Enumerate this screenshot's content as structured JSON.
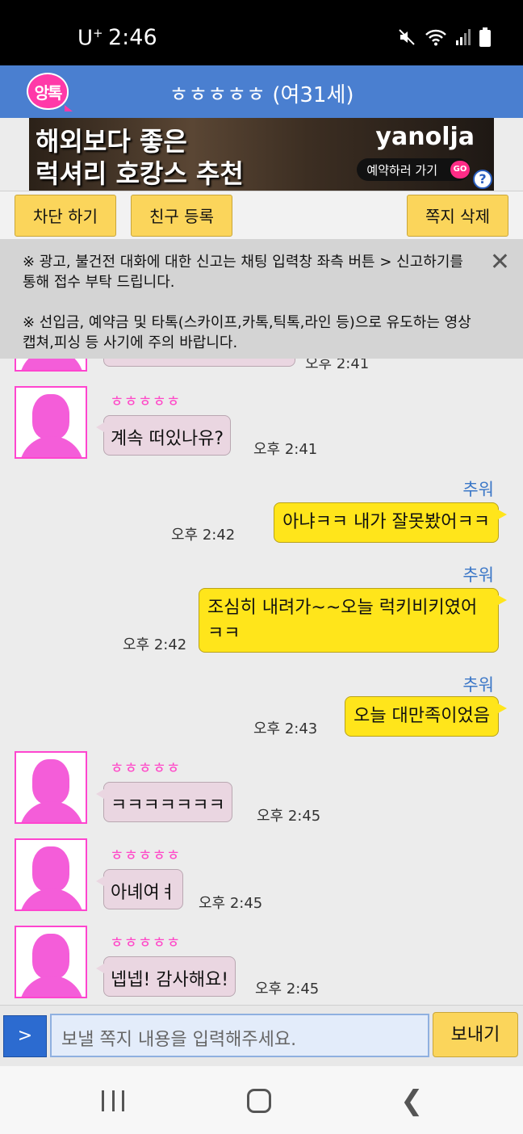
{
  "status_bar": {
    "carrier": "U",
    "carrier_sup": "+",
    "time": "2:46"
  },
  "app": {
    "logo_text": "앙톡",
    "title": "ㅎㅎㅎㅎㅎ (여31세)"
  },
  "ad": {
    "line1": "해외보다 좋은",
    "line2": "럭셔리 호캉스 추천",
    "brand": "yanolja",
    "cta": "예약하러 가기",
    "go": "GO",
    "help": "?"
  },
  "actions": {
    "block": "차단 하기",
    "add_friend": "친구 등록",
    "delete_notes": "쪽지 삭제"
  },
  "notice": {
    "line1": "※ 광고, 불건전 대화에 대한 신고는 채팅 입력창 좌측 버튼 > 신고하기를 통해 접수 부탁 드립니다.",
    "line2": "※ 선입금, 예약금 및 타톡(스카이프,카톡,틱톡,라인 등)으로 유도하는 영상캡쳐,피싱 등 사기에 주의 바랍니다.",
    "close": "✕"
  },
  "messages": [
    {
      "from": "them",
      "sender": "ㅎㅎㅎㅎㅎ",
      "text": "계속 떠있나유?",
      "time": "오후 2:41"
    },
    {
      "from": "me",
      "sender": "추워",
      "text": "아냐ㅋㅋ 내가 잘못봤어ㅋㅋ",
      "time": "오후 2:42"
    },
    {
      "from": "me",
      "sender": "추워",
      "text": "조심히 내려가~~오늘 럭키비키였어ㅋㅋ",
      "time": "오후 2:42"
    },
    {
      "from": "me",
      "sender": "추워",
      "text": "오늘 대만족이었음",
      "time": "오후 2:43"
    },
    {
      "from": "them",
      "sender": "ㅎㅎㅎㅎㅎ",
      "text": "ㅋㅋㅋㅋㅋㅋㅋ",
      "time": "오후 2:45"
    },
    {
      "from": "them",
      "sender": "ㅎㅎㅎㅎㅎ",
      "text": "아녜여ㅕ",
      "time": "오후 2:45"
    },
    {
      "from": "them",
      "sender": "ㅎㅎㅎㅎㅎ",
      "text": "넵넵! 감사해요!",
      "time": "오후 2:45"
    }
  ],
  "partial_top_time": "오후 2:41",
  "input": {
    "report_label": ">",
    "placeholder": "보낼 쪽지 내용을 입력해주세요.",
    "send": "보내기"
  },
  "colors": {
    "title_bar": "#4a7fd0",
    "outgoing": "#ffe51b",
    "incoming": "#ead6e1",
    "button": "#fbd55b",
    "sender_name": "#ff48c8"
  }
}
